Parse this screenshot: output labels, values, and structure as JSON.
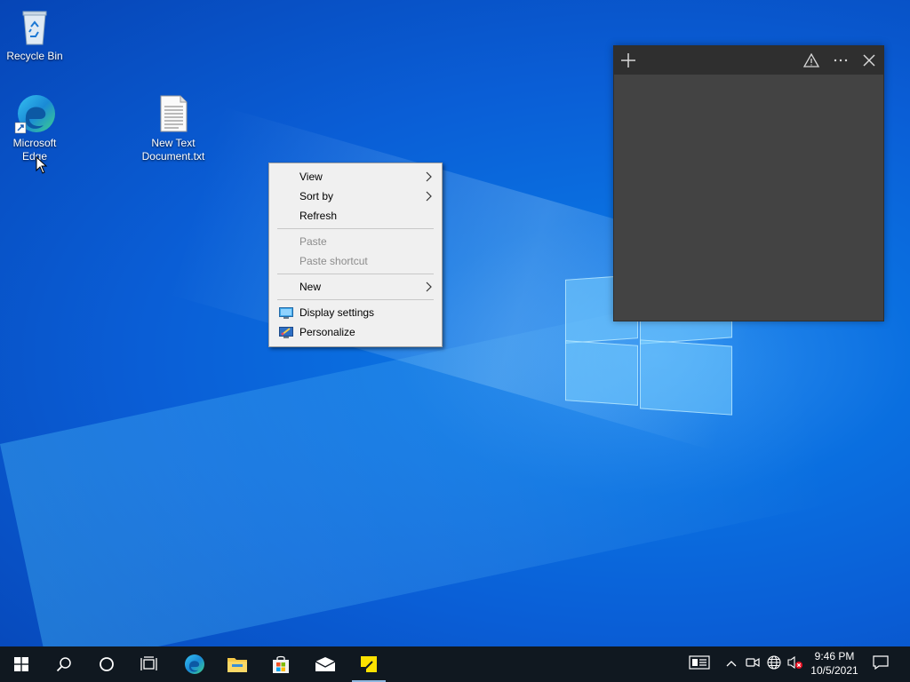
{
  "desktop": {
    "icons": [
      {
        "name": "recycle-bin",
        "label": "Recycle Bin"
      },
      {
        "name": "microsoft-edge",
        "label": "Microsoft Edge"
      },
      {
        "name": "new-text-document",
        "label": "New Text Document.txt"
      }
    ]
  },
  "context_menu": {
    "items": [
      {
        "label": "View",
        "has_submenu": true,
        "enabled": true
      },
      {
        "label": "Sort by",
        "has_submenu": true,
        "enabled": true
      },
      {
        "label": "Refresh",
        "has_submenu": false,
        "enabled": true
      },
      {
        "label": "Paste",
        "has_submenu": false,
        "enabled": false
      },
      {
        "label": "Paste shortcut",
        "has_submenu": false,
        "enabled": false
      },
      {
        "label": "New",
        "has_submenu": true,
        "enabled": true
      },
      {
        "label": "Display settings",
        "icon": "display-settings-icon",
        "enabled": true
      },
      {
        "label": "Personalize",
        "icon": "personalize-icon",
        "enabled": true
      }
    ]
  },
  "sticky_note": {
    "theme": "charcoal",
    "buttons": [
      "add-note-icon",
      "warning-icon",
      "more-options-icon",
      "close-icon"
    ]
  },
  "taskbar": {
    "pinned": [
      "start-icon",
      "search-icon",
      "cortana-icon",
      "task-view-icon",
      "edge-icon",
      "file-explorer-icon",
      "store-icon",
      "mail-icon",
      "sticky-notes-icon"
    ],
    "active_app": "sticky-notes-icon",
    "tray": [
      "news-icon",
      "chevron-up-icon",
      "meet-now-icon",
      "network-icon",
      "volume-muted-icon",
      "notifications-icon"
    ],
    "clock": {
      "time": "9:46 PM",
      "date": "10/5/2021"
    }
  },
  "colors": {
    "taskbar": "#101820",
    "sticky_body": "#434343",
    "sticky_bar": "#2f2f2f",
    "menu_bg": "#f0f0f0"
  }
}
